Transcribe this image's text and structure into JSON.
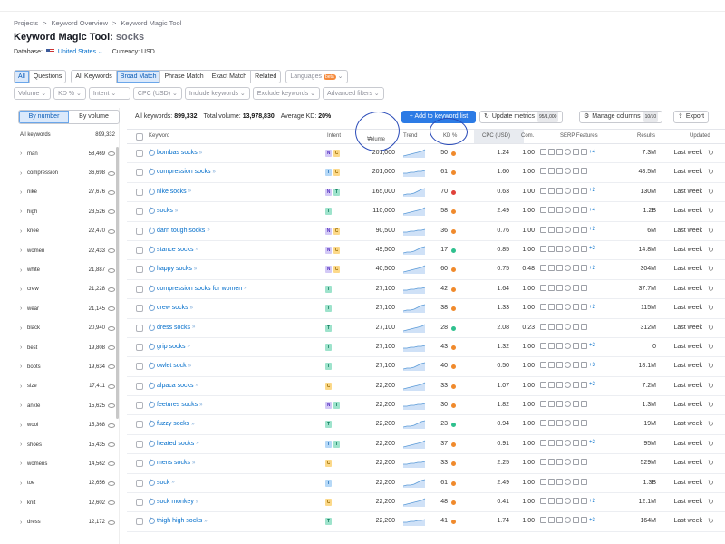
{
  "breadcrumb": [
    "Projects",
    ">",
    "Keyword Overview",
    ">",
    "Keyword Magic Tool"
  ],
  "page": {
    "title": "Keyword Magic Tool:",
    "phrase": "socks",
    "database_label": "Database:",
    "database_value": "United States",
    "currency": "Currency: USD"
  },
  "tabs": {
    "all": "All",
    "questions": "Questions",
    "all_keywords": "All Keywords",
    "broad": "Broad Match",
    "phrase": "Phrase Match",
    "exact": "Exact Match",
    "related": "Related",
    "languages": "Languages",
    "beta": "beta"
  },
  "filters": [
    "Volume",
    "KD %",
    "Intent",
    "CPC (USD)",
    "Include keywords",
    "Exclude keywords",
    "Advanced filters"
  ],
  "sidebar": {
    "by_number": "By number",
    "by_volume": "By volume",
    "all_label": "All keywords",
    "all_count": "899,332",
    "items": [
      [
        "man",
        "58,469"
      ],
      [
        "compression",
        "36,698"
      ],
      [
        "nike",
        "27,676"
      ],
      [
        "high",
        "23,526"
      ],
      [
        "knee",
        "22,470"
      ],
      [
        "women",
        "22,433"
      ],
      [
        "white",
        "21,887"
      ],
      [
        "crew",
        "21,228"
      ],
      [
        "wear",
        "21,145"
      ],
      [
        "black",
        "20,940"
      ],
      [
        "best",
        "19,808"
      ],
      [
        "boots",
        "19,634"
      ],
      [
        "size",
        "17,411"
      ],
      [
        "ankle",
        "15,625"
      ],
      [
        "wool",
        "15,368"
      ],
      [
        "shoes",
        "15,435"
      ],
      [
        "womens",
        "14,562"
      ],
      [
        "toe",
        "12,656"
      ],
      [
        "knit",
        "12,602"
      ],
      [
        "dress",
        "12,172"
      ]
    ]
  },
  "summary": {
    "all_label": "All keywords:",
    "all_value": "899,332",
    "vol_label": "Total volume:",
    "vol_value": "13,978,830",
    "kd_label": "Average KD:",
    "kd_value": "20%"
  },
  "toolbar": {
    "add": "+ Add to keyword list",
    "update": "Update metrics",
    "update_count": "95/1,000",
    "manage": "Manage columns",
    "manage_count": "10/10",
    "export": "Export"
  },
  "columns": {
    "keyword": "Keyword",
    "intent": "Intent",
    "volume": "Volume",
    "trend": "Trend",
    "kd": "KD %",
    "cpc": "CPC (USD)",
    "com": "Com.",
    "serp": "SERP Features",
    "results": "Results",
    "updated": "Updated"
  },
  "colors": {
    "kd_red": "#e0413a",
    "kd_orange": "#f08a2c",
    "kd_green": "#2fc08e",
    "accent": "#2c7be5"
  },
  "rows": [
    {
      "kw": "bombas socks",
      "intent": [
        "N",
        "C"
      ],
      "vol": "201,000",
      "kd": "50",
      "kdc": "#f08a2c",
      "cpc": "1.24",
      "com": "1.00",
      "plus": "+4",
      "res": "7.3M",
      "upd": "Last week"
    },
    {
      "kw": "compression socks",
      "intent": [
        "I",
        "C"
      ],
      "vol": "201,000",
      "kd": "61",
      "kdc": "#f08a2c",
      "cpc": "1.60",
      "com": "1.00",
      "plus": "",
      "res": "48.5M",
      "upd": "Last week"
    },
    {
      "kw": "nike socks",
      "intent": [
        "N",
        "T"
      ],
      "vol": "165,000",
      "kd": "70",
      "kdc": "#e0413a",
      "cpc": "0.63",
      "com": "1.00",
      "plus": "+2",
      "res": "130M",
      "upd": "Last week"
    },
    {
      "kw": "socks",
      "intent": [
        "T"
      ],
      "vol": "110,000",
      "kd": "58",
      "kdc": "#f08a2c",
      "cpc": "2.49",
      "com": "1.00",
      "plus": "+4",
      "res": "1.2B",
      "upd": "Last week"
    },
    {
      "kw": "darn tough socks",
      "intent": [
        "N",
        "C"
      ],
      "vol": "90,500",
      "kd": "36",
      "kdc": "#f08a2c",
      "cpc": "0.76",
      "com": "1.00",
      "plus": "+2",
      "res": "6M",
      "upd": "Last week"
    },
    {
      "kw": "stance socks",
      "intent": [
        "N",
        "C"
      ],
      "vol": "49,500",
      "kd": "17",
      "kdc": "#2fc08e",
      "cpc": "0.85",
      "com": "1.00",
      "plus": "+2",
      "res": "14.8M",
      "upd": "Last week"
    },
    {
      "kw": "happy socks",
      "intent": [
        "N",
        "C"
      ],
      "vol": "40,500",
      "kd": "60",
      "kdc": "#f08a2c",
      "cpc": "0.75",
      "com": "0.48",
      "plus": "+2",
      "res": "304M",
      "upd": "Last week"
    },
    {
      "kw": "compression socks for women",
      "intent": [
        "T"
      ],
      "vol": "27,100",
      "kd": "42",
      "kdc": "#f08a2c",
      "cpc": "1.64",
      "com": "1.00",
      "plus": "",
      "res": "37.7M",
      "upd": "Last week"
    },
    {
      "kw": "crew socks",
      "intent": [
        "T"
      ],
      "vol": "27,100",
      "kd": "38",
      "kdc": "#f08a2c",
      "cpc": "1.33",
      "com": "1.00",
      "plus": "+2",
      "res": "115M",
      "upd": "Last week"
    },
    {
      "kw": "dress socks",
      "intent": [
        "T"
      ],
      "vol": "27,100",
      "kd": "28",
      "kdc": "#2fc08e",
      "cpc": "2.08",
      "com": "0.23",
      "plus": "",
      "res": "312M",
      "upd": "Last week"
    },
    {
      "kw": "grip socks",
      "intent": [
        "T"
      ],
      "vol": "27,100",
      "kd": "43",
      "kdc": "#f08a2c",
      "cpc": "1.32",
      "com": "1.00",
      "plus": "+2",
      "res": "0",
      "upd": "Last week"
    },
    {
      "kw": "owlet sock",
      "intent": [
        "T"
      ],
      "vol": "27,100",
      "kd": "40",
      "kdc": "#f08a2c",
      "cpc": "0.50",
      "com": "1.00",
      "plus": "+3",
      "res": "18.1M",
      "upd": "Last week"
    },
    {
      "kw": "alpaca socks",
      "intent": [
        "C"
      ],
      "vol": "22,200",
      "kd": "33",
      "kdc": "#f08a2c",
      "cpc": "1.07",
      "com": "1.00",
      "plus": "+2",
      "res": "7.2M",
      "upd": "Last week"
    },
    {
      "kw": "feetures socks",
      "intent": [
        "N",
        "T"
      ],
      "vol": "22,200",
      "kd": "30",
      "kdc": "#f08a2c",
      "cpc": "1.82",
      "com": "1.00",
      "plus": "",
      "res": "1.3M",
      "upd": "Last week"
    },
    {
      "kw": "fuzzy socks",
      "intent": [
        "T"
      ],
      "vol": "22,200",
      "kd": "23",
      "kdc": "#2fc08e",
      "cpc": "0.94",
      "com": "1.00",
      "plus": "",
      "res": "19M",
      "upd": "Last week"
    },
    {
      "kw": "heated socks",
      "intent": [
        "I",
        "T"
      ],
      "vol": "22,200",
      "kd": "37",
      "kdc": "#f08a2c",
      "cpc": "0.91",
      "com": "1.00",
      "plus": "+2",
      "res": "95M",
      "upd": "Last week"
    },
    {
      "kw": "mens socks",
      "intent": [
        "C"
      ],
      "vol": "22,200",
      "kd": "33",
      "kdc": "#f08a2c",
      "cpc": "2.25",
      "com": "1.00",
      "plus": "",
      "res": "529M",
      "upd": "Last week"
    },
    {
      "kw": "sock",
      "intent": [
        "I"
      ],
      "vol": "22,200",
      "kd": "61",
      "kdc": "#f08a2c",
      "cpc": "2.49",
      "com": "1.00",
      "plus": "",
      "res": "1.3B",
      "upd": "Last week"
    },
    {
      "kw": "sock monkey",
      "intent": [
        "C"
      ],
      "vol": "22,200",
      "kd": "48",
      "kdc": "#f08a2c",
      "cpc": "0.41",
      "com": "1.00",
      "plus": "+2",
      "res": "12.1M",
      "upd": "Last week"
    },
    {
      "kw": "thigh high socks",
      "intent": [
        "T"
      ],
      "vol": "22,200",
      "kd": "41",
      "kdc": "#f08a2c",
      "cpc": "1.74",
      "com": "1.00",
      "plus": "+3",
      "res": "164M",
      "upd": "Last week"
    }
  ]
}
